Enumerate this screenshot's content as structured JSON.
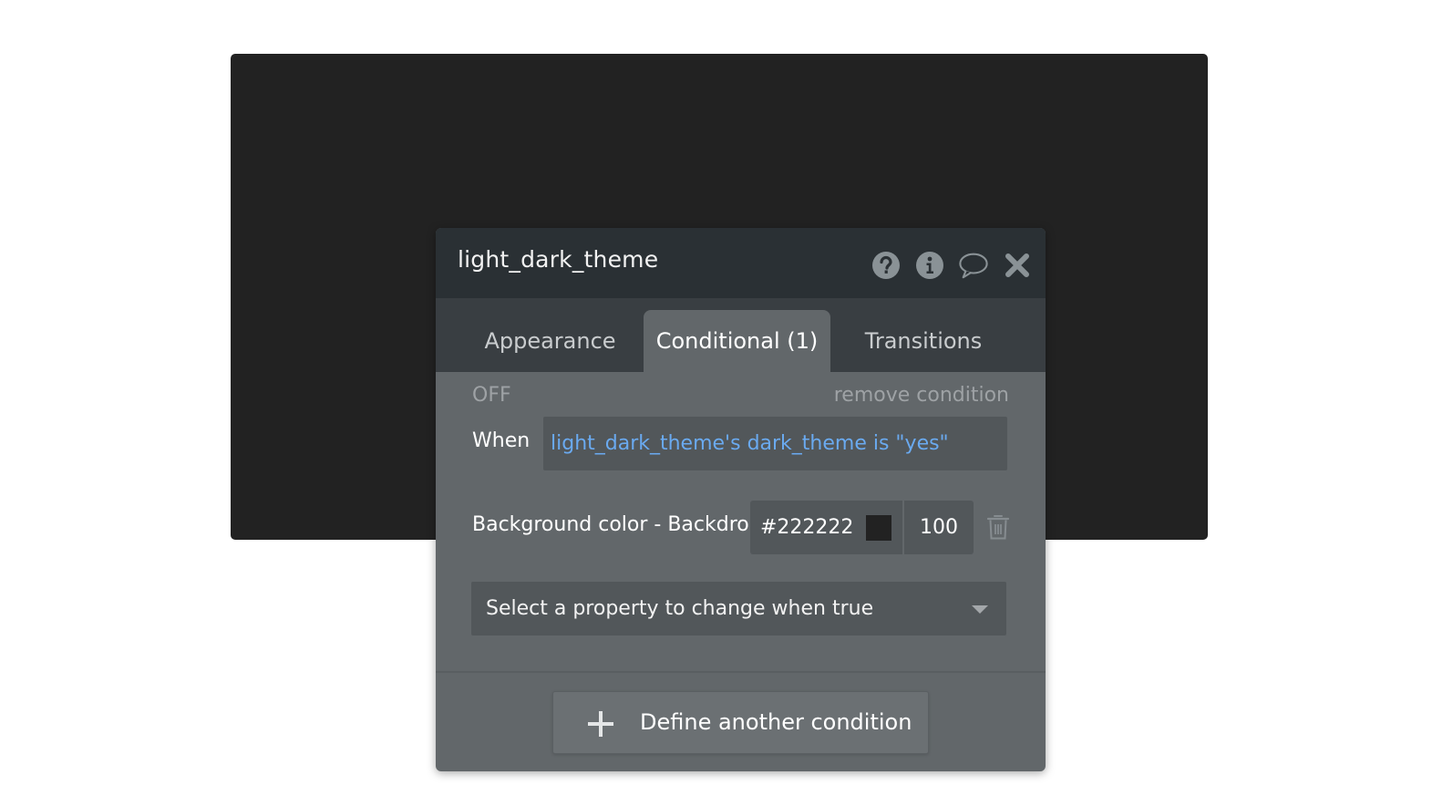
{
  "panel": {
    "title": "light_dark_theme",
    "header_icons": [
      "help-icon",
      "info-icon",
      "comment-icon",
      "close-icon"
    ]
  },
  "tabs": [
    {
      "label": "Appearance",
      "active": false
    },
    {
      "label": "Conditional (1)",
      "active": true
    },
    {
      "label": "Transitions",
      "active": false
    }
  ],
  "condition": {
    "toggle_label": "OFF",
    "remove_label": "remove condition",
    "when_label": "When",
    "expression": "light_dark_theme's dark_theme is \"yes\"",
    "property_label": "Background color - Backdro",
    "color_hex": "#222222",
    "swatch_color": "#222222",
    "opacity": "100",
    "select_placeholder": "Select a property to change when true"
  },
  "footer": {
    "define_label": "Define another condition"
  },
  "colors": {
    "backdrop": "#222222",
    "expression_text": "#6aaaf0"
  }
}
